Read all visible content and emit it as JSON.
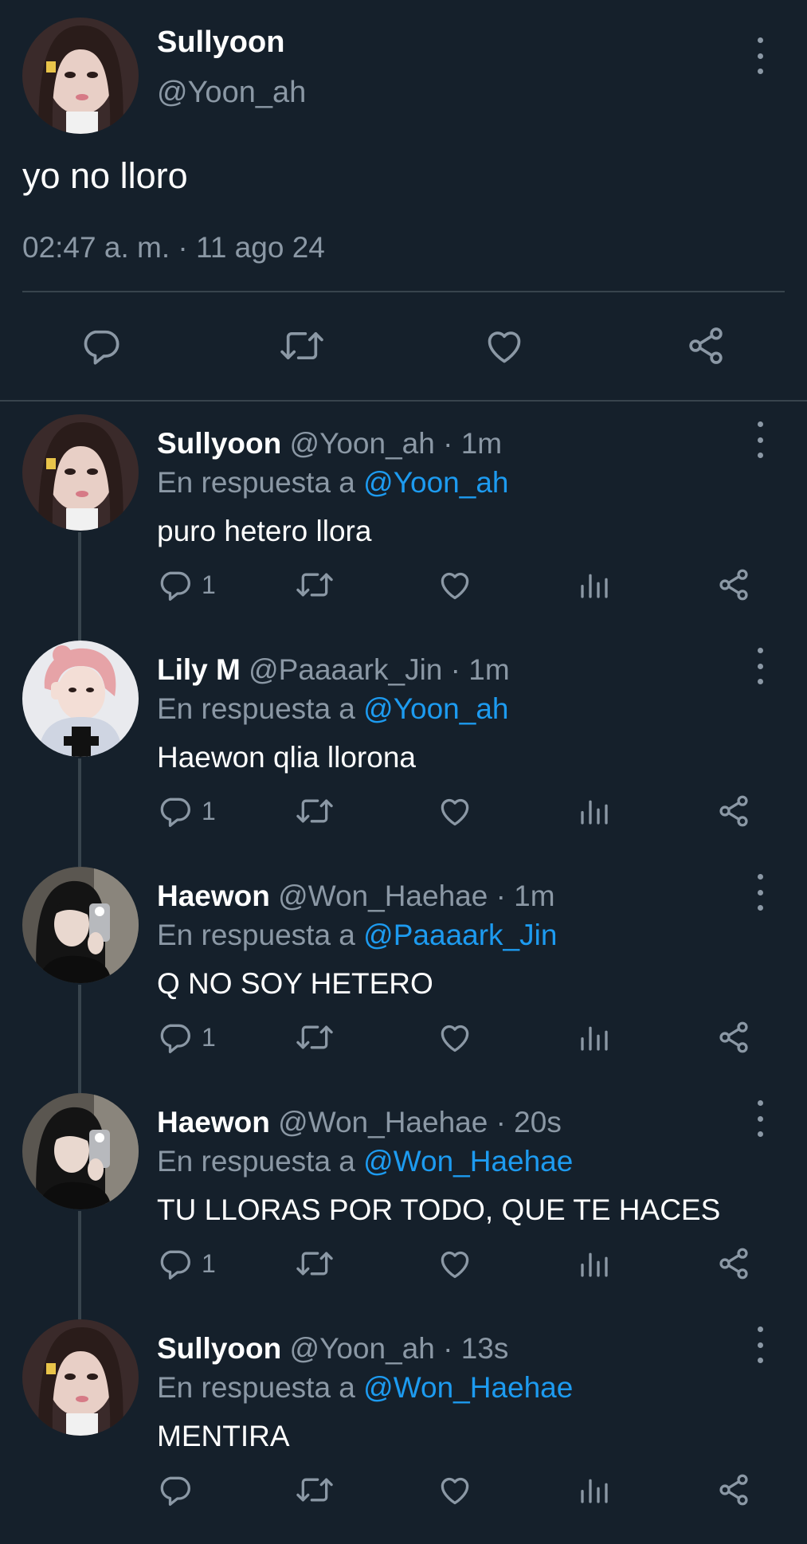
{
  "main_tweet": {
    "name": "Sullyoon",
    "handle": "@Yoon_ah",
    "text": "yo no lloro",
    "timestamp": "02:47 a. m. · 11 ago 24"
  },
  "replies": [
    {
      "name": "Sullyoon",
      "handle": "@Yoon_ah",
      "time": "· 1m",
      "reply_prefix": "En respuesta a",
      "reply_to": "@Yoon_ah",
      "text": "puro hetero llora",
      "reply_count": "1"
    },
    {
      "name": "Lily M",
      "handle": "@Paaaark_Jin",
      "time": "· 1m",
      "reply_prefix": "En respuesta a",
      "reply_to": "@Yoon_ah",
      "text": "Haewon qlia llorona",
      "reply_count": "1"
    },
    {
      "name": "Haewon",
      "handle": "@Won_Haehae",
      "time": "· 1m",
      "reply_prefix": "En respuesta a",
      "reply_to": "@Paaaark_Jin",
      "text": "Q NO SOY HETERO",
      "reply_count": "1"
    },
    {
      "name": "Haewon",
      "handle": "@Won_Haehae",
      "time": "· 20s",
      "reply_prefix": "En respuesta a",
      "reply_to": "@Won_Haehae",
      "text": "TU LLORAS POR TODO, QUE TE HACES",
      "reply_count": "1"
    },
    {
      "name": "Sullyoon",
      "handle": "@Yoon_ah",
      "time": "· 13s",
      "reply_prefix": "En respuesta a",
      "reply_to": "@Won_Haehae",
      "text": "MENTIRA",
      "reply_count": ""
    }
  ],
  "icons": {
    "reply": "comment-icon",
    "retweet": "retweet-icon",
    "like": "heart-icon",
    "views": "views-icon",
    "share": "share-icon",
    "more": "more-vertical-icon"
  },
  "colors": {
    "background": "#15202b",
    "secondary_text": "#8b98a5",
    "link": "#1d9bf0",
    "divider": "#38444d"
  }
}
